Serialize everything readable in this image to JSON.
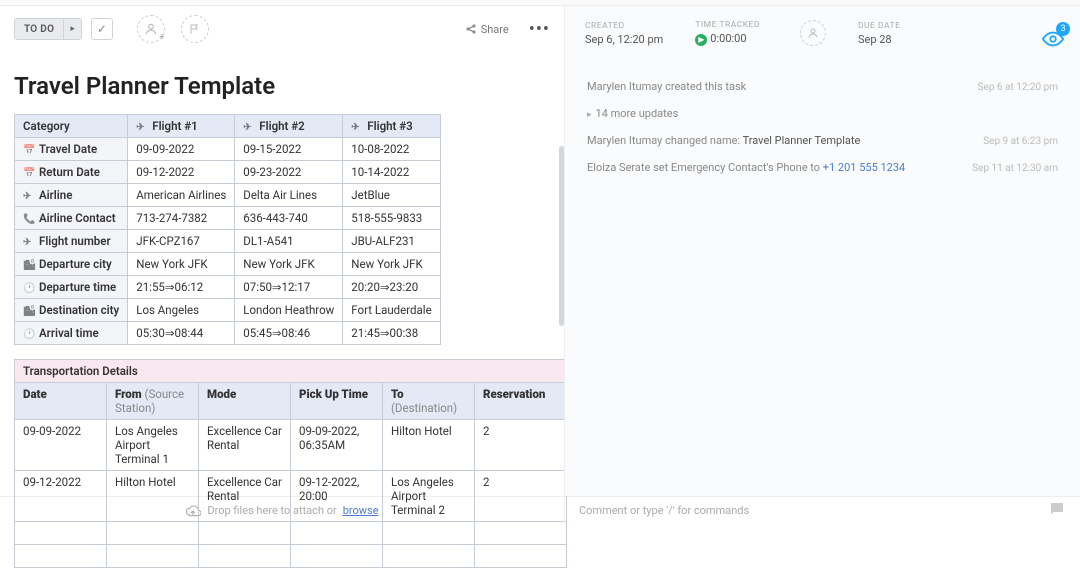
{
  "toolbar": {
    "status": "TO DO",
    "share": "Share"
  },
  "title": "Travel Planner Template",
  "flights": {
    "headers": [
      "Category",
      "Flight #1",
      "Flight #2",
      "Flight #3"
    ],
    "rows": [
      {
        "ico": "📅",
        "label": "Travel Date",
        "c": [
          "09-09-2022",
          "09-15-2022",
          "10-08-2022"
        ]
      },
      {
        "ico": "📅",
        "label": "Return Date",
        "c": [
          "09-12-2022",
          "09-23-2022",
          "10-14-2022"
        ]
      },
      {
        "ico": "✈",
        "label": "Airline",
        "c": [
          "American Airlines",
          "Delta Air Lines",
          "JetBlue"
        ]
      },
      {
        "ico": "📞",
        "label": "Airline Contact",
        "c": [
          "713-274-7382",
          "636-443-740",
          "518-555-9833"
        ]
      },
      {
        "ico": "✈",
        "label": "Flight number",
        "c": [
          "JFK-CPZ167",
          "DL1-A541",
          "JBU-ALF231"
        ]
      },
      {
        "ico": "🏙",
        "label": "Departure city",
        "c": [
          "New York JFK",
          "New York JFK",
          "New York JFK"
        ]
      },
      {
        "ico": "🕐",
        "label": "Departure time",
        "c": [
          "21:55⇒06:12",
          "07:50⇒12:17",
          "20:20⇒23:20"
        ]
      },
      {
        "ico": "🏙",
        "label": "Destination city",
        "c": [
          "Los Angeles",
          "London Heathrow",
          "Fort Lauderdale"
        ]
      },
      {
        "ico": "🕐",
        "label": "Arrival time",
        "c": [
          "05:30⇒08:44",
          "05:45⇒08:46",
          "21:45⇒00:38"
        ]
      }
    ]
  },
  "transport": {
    "title": "Transportation Details",
    "headers": [
      {
        "a": "Date",
        "b": ""
      },
      {
        "a": "From",
        "b": " (Source Station)"
      },
      {
        "a": "Mode",
        "b": ""
      },
      {
        "a": "Pick Up Time",
        "b": ""
      },
      {
        "a": "To",
        "b": " (Destination)"
      },
      {
        "a": "Reservation",
        "b": ""
      }
    ],
    "rows": [
      [
        "09-09-2022",
        "Los Angeles Airport Terminal 1",
        "Excellence Car Rental",
        "09-09-2022, 06:35AM",
        "Hilton Hotel",
        "2"
      ],
      [
        "09-12-2022",
        "Hilton Hotel",
        "Excellence Car Rental",
        "09-12-2022, 20:00",
        "Los Angeles Airport Terminal 2",
        "2"
      ],
      [
        "",
        "",
        "",
        "",
        "",
        ""
      ],
      [
        "",
        "",
        "",
        "",
        "",
        ""
      ]
    ]
  },
  "meta": {
    "created": {
      "lbl": "CREATED",
      "val": "Sep 6, 12:20 pm"
    },
    "tracked": {
      "lbl": "TIME TRACKED",
      "val": "0:00:00"
    },
    "due": {
      "lbl": "DUE DATE",
      "val": "Sep 28"
    },
    "watch_count": "3"
  },
  "activity": [
    {
      "body_pre": "Marylen Itumay created this task",
      "body_strong": "",
      "body_post": "",
      "ts": "Sep 6 at 12:20 pm",
      "type": "plain"
    },
    {
      "body_pre": "14 more updates",
      "ts": "",
      "type": "more"
    },
    {
      "body_pre": "Marylen Itumay changed name: ",
      "body_strong": "Travel Planner Template",
      "body_post": "",
      "ts": "Sep 9 at 6:23 pm",
      "type": "name"
    },
    {
      "body_pre": "Eloiza Serate set Emergency Contact's Phone to ",
      "body_strong": "+1 201 555 1234",
      "body_post": "",
      "ts": "Sep 11 at 12:30 am",
      "type": "phone"
    }
  ],
  "footer": {
    "drop": "Drop files here to attach or ",
    "browse": "browse",
    "comment": "Comment or type '/' for commands"
  }
}
